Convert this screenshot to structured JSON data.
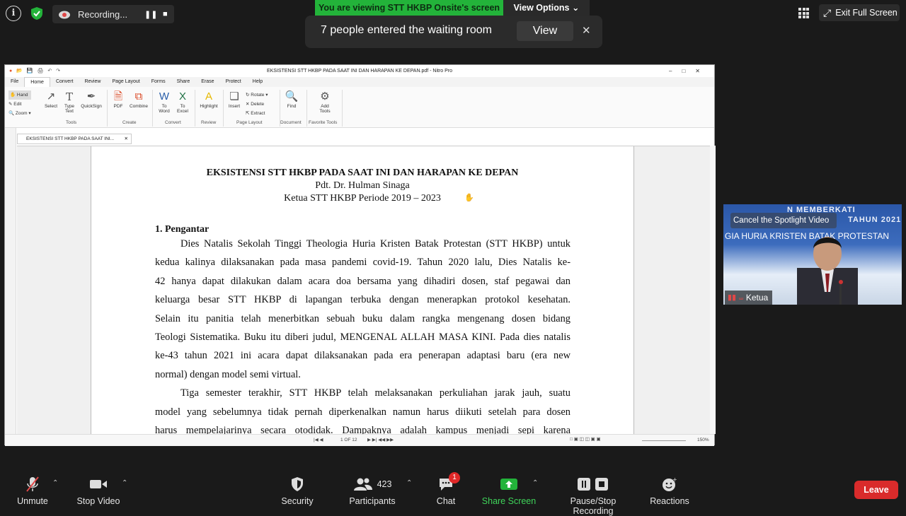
{
  "top": {
    "recording_label": "Recording...",
    "viewing_banner": "You are viewing STT HKBP Onsite's screen",
    "view_options": "View Options ⌄",
    "waiting_message": "7 people entered the waiting room",
    "waiting_view": "View",
    "waiting_close": "✕",
    "exit_fullscreen": "Exit Full Screen"
  },
  "nitro": {
    "title": "EKSISTENSI STT HKBP PADA SAAT INI DAN HARAPAN KE DEPAN.pdf - Nitro Pro",
    "menu": [
      "File",
      "Home",
      "Convert",
      "Review",
      "Page Layout",
      "Forms",
      "Share",
      "Erase",
      "Protect",
      "Help"
    ],
    "ribbon": {
      "hand": "Hand",
      "edit": "Edit",
      "zoom": "Zoom",
      "select": "Select",
      "type_text": "Type Text",
      "quicksign": "QuickSign",
      "pdf": "PDF",
      "combine": "Combine",
      "to_word": "To Word",
      "to_excel": "To Excel",
      "highlight": "Highlight",
      "insert": "Insert",
      "rotate": "Rotate",
      "delete": "Delete",
      "extract": "Extract",
      "find": "Find",
      "add_tools": "Add Tools"
    },
    "groups": [
      "Tools",
      "Create",
      "Convert",
      "Review",
      "Page Layout",
      "Document",
      "Favorite Tools"
    ],
    "doc_tab": "EKSISTENSI STT HKBP PADA SAAT INI...",
    "page_indicator": "1 OF 12",
    "zoom": "150%"
  },
  "document": {
    "title": "EKSISTENSI STT HKBP PADA SAAT INI DAN HARAPAN KE DEPAN",
    "author": "Pdt. Dr. Hulman Sinaga",
    "role": "Ketua STT HKBP Periode 2019 – 2023",
    "heading": "1.  Pengantar",
    "lines": [
      "Dies Natalis Sekolah Tinggi Theologia Huria Kristen Batak Protestan (STT HKBP) untuk",
      "kedua kalinya dilaksanakan pada masa pandemi covid-19. Tahun 2020 lalu, Dies Natalis ke-",
      "42 hanya dapat dilakukan dalam acara doa bersama yang dihadiri dosen, staf pegawai dan",
      "keluarga besar STT HKBP di lapangan terbuka dengan menerapkan protokol kesehatan.",
      "Selain itu panitia telah menerbitkan sebuah buku dalam rangka mengenang dosen bidang",
      "Teologi Sistematika. Buku itu diberi judul, MENGENAL ALLAH MASA KINI. Pada dies natalis",
      "ke-43 tahun 2021 ini acara dapat dilaksanakan pada era penerapan adaptasi baru (era new",
      "normal) dengan model semi virtual.",
      "Tiga semester terakhir, STT HKBP telah melaksanakan perkuliahan jarak jauh, suatu",
      "model yang sebelumnya tidak pernah diperkenalkan namun harus diikuti setelah para dosen",
      "harus mempelajarinya secara otodidak. Dampaknya adalah kampus menjadi sepi karena"
    ]
  },
  "video": {
    "cancel_spotlight": "Cancel the Spotlight Video",
    "bg_line1": "N MEMBERKATI",
    "bg_line2": "GIA HURIA KRISTEN BATAK PROTESTAN",
    "bg_year": "TAHUN 2021",
    "name": "Ketua"
  },
  "toolbar": {
    "unmute": "Unmute",
    "stop_video": "Stop Video",
    "security": "Security",
    "participants": "Participants",
    "participant_count": "423",
    "chat": "Chat",
    "chat_badge": "1",
    "share_screen": "Share Screen",
    "pause_stop_recording": "Pause/Stop Recording",
    "reactions": "Reactions",
    "leave": "Leave"
  },
  "colors": {
    "banner_green": "#23b33a",
    "share_green": "#23b33a",
    "leave_red": "#d92b2b"
  }
}
